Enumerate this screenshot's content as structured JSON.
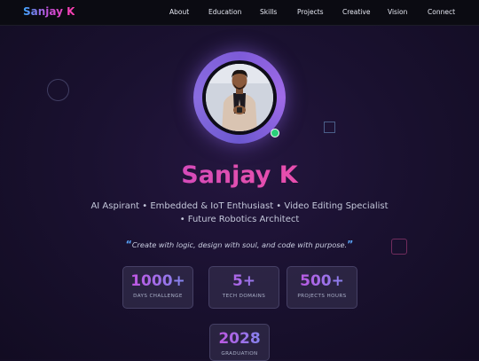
{
  "nav": {
    "logo": "Sanjay K",
    "links": [
      "About",
      "Education",
      "Skills",
      "Projects",
      "Creative",
      "Vision",
      "Connect"
    ]
  },
  "hero": {
    "name": "Sanjay K",
    "role_line1": "AI Aspirant • Embedded & IoT Enthusiast • Video Editing Specialist",
    "role_line2": "• Future Robotics Architect",
    "quote_open": "“",
    "quote": "Create with logic, design with soul, and code with purpose.",
    "quote_close": "”"
  },
  "stats": [
    {
      "value": "1000+",
      "label": "DAYS CHALLENGE"
    },
    {
      "value": "5+",
      "label": "TECH DOMAINS"
    },
    {
      "value": "500+",
      "label": "PROJECTS HOURS"
    },
    {
      "value": "2028",
      "label": "GRADUATION"
    }
  ],
  "colors": {
    "accent_pink": "#e04fb0",
    "accent_blue": "#5aa7ff",
    "accent_purple": "#7d5bd8",
    "status_online": "#29d07a",
    "nav_bg": "#0b0b12"
  }
}
